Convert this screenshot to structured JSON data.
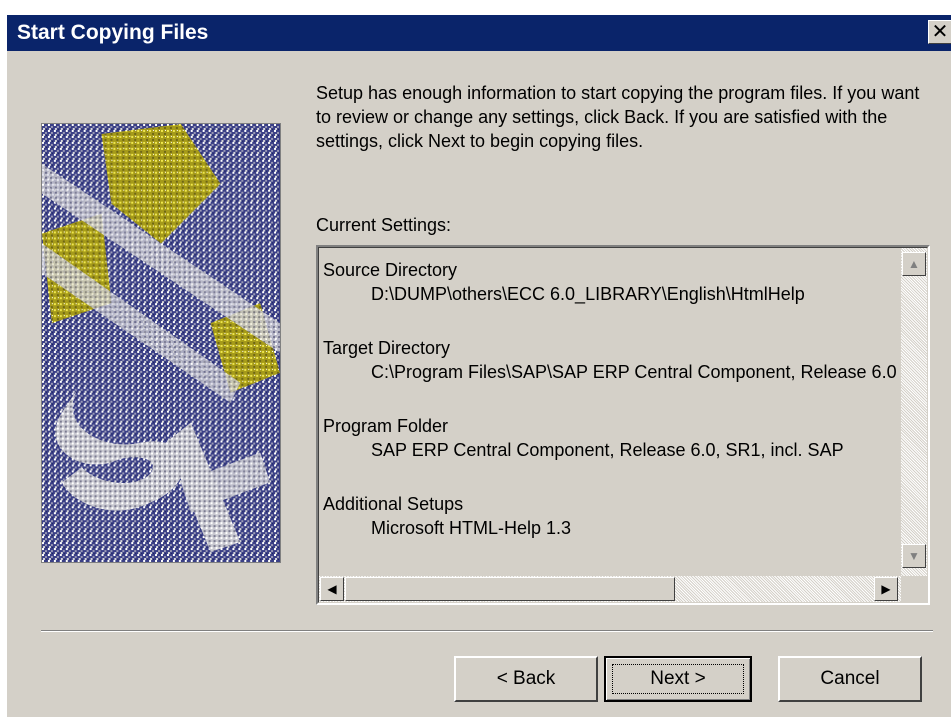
{
  "window": {
    "title": "Start Copying Files",
    "close_glyph": "✕"
  },
  "intro_text": "Setup has enough information to start copying the program files. If you want to review or change any settings, click Back.  If you are satisfied with the settings, click Next to begin copying files.",
  "settings": {
    "label": "Current Settings:",
    "groups": [
      {
        "heading": "Source Directory",
        "value": "D:\\DUMP\\others\\ECC 6.0_LIBRARY\\English\\HtmlHelp"
      },
      {
        "heading": "Target Directory",
        "value": "C:\\Program Files\\SAP\\SAP ERP Central Component, Release 6.0"
      },
      {
        "heading": "Program Folder",
        "value": "SAP ERP Central Component, Release 6.0, SR1, incl. SAP"
      },
      {
        "heading": "Additional Setups",
        "value": "Microsoft HTML-Help 1.3"
      }
    ]
  },
  "buttons": {
    "back": "< Back",
    "next": "Next >",
    "cancel": "Cancel"
  },
  "icons": {
    "close": "close-icon",
    "scroll_up": "scroll-up-arrow-icon",
    "scroll_down": "scroll-down-arrow-icon",
    "scroll_left": "scroll-left-arrow-icon",
    "scroll_right": "scroll-right-arrow-icon"
  },
  "colors": {
    "titlebar": "#0a246a",
    "dialog_face": "#d4d0c8",
    "image_accent": "#b5a81c"
  }
}
